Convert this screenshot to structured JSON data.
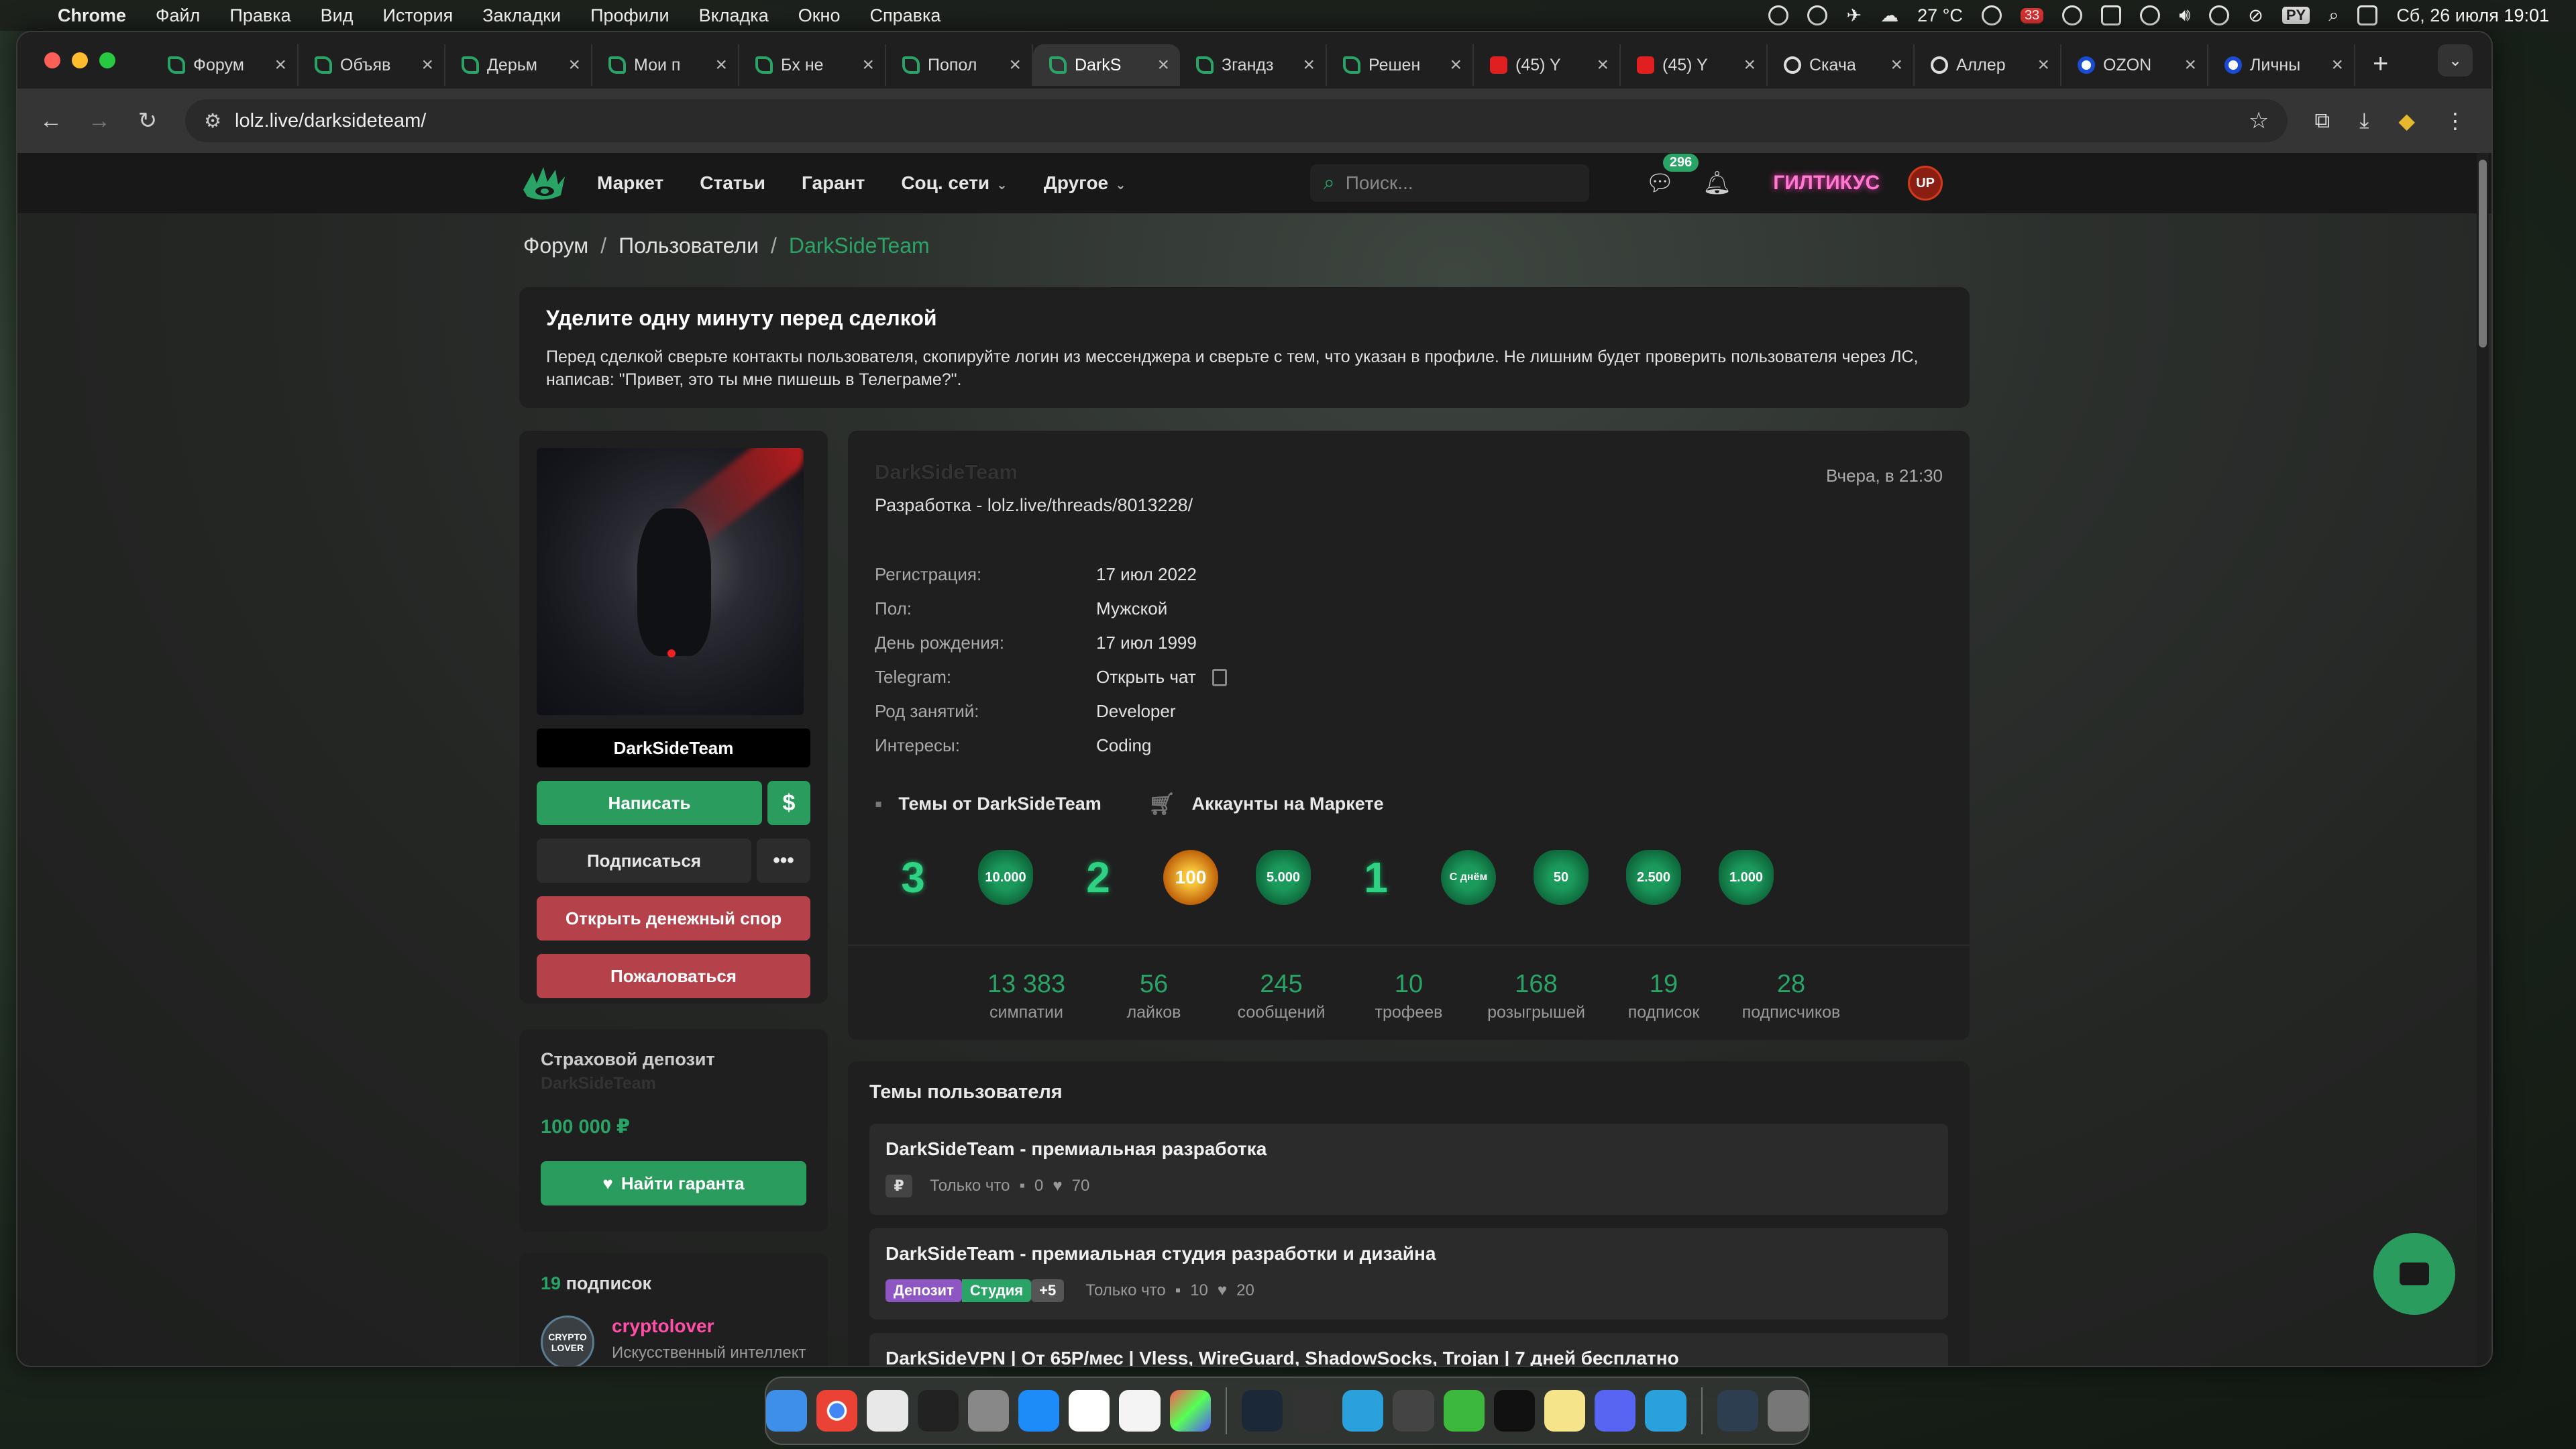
{
  "menubar": {
    "app_name": "Chrome",
    "items": [
      "Файл",
      "Правка",
      "Вид",
      "История",
      "Закладки",
      "Профили",
      "Вкладка",
      "Окно",
      "Справка"
    ],
    "temperature": "27 °C",
    "keyboard_layout": "PY",
    "datetime": "Сб, 26 июля 19:01",
    "notification_count": "33"
  },
  "browser": {
    "tabs": [
      {
        "title": "Форум",
        "favicon": "lolz-icon"
      },
      {
        "title": "Объяв",
        "favicon": "lolz-icon"
      },
      {
        "title": "Дерьм",
        "favicon": "lolz-icon"
      },
      {
        "title": "Мои п",
        "favicon": "lolz-icon"
      },
      {
        "title": "Бх не",
        "favicon": "lolz-icon"
      },
      {
        "title": "Попол",
        "favicon": "lolz-icon"
      },
      {
        "title": "DarkS",
        "favicon": "lolz-icon",
        "active": true
      },
      {
        "title": "Згандз",
        "favicon": "lolz-icon"
      },
      {
        "title": "Решен",
        "favicon": "lolz-icon"
      },
      {
        "title": "(45) Y",
        "favicon": "youtube-icon"
      },
      {
        "title": "(45) Y",
        "favicon": "youtube-icon"
      },
      {
        "title": "Скача",
        "favicon": "github-icon"
      },
      {
        "title": "Аллер",
        "favicon": "github-icon"
      },
      {
        "title": "OZON",
        "favicon": "ozon-icon"
      },
      {
        "title": "Личны",
        "favicon": "ozon-icon"
      }
    ],
    "url": "lolz.live/darksideteam/"
  },
  "site": {
    "nav": [
      "Маркет",
      "Статьи",
      "Гарант",
      "Соц. сети",
      "Другое"
    ],
    "search_placeholder": "Поиск...",
    "messages_badge": "296",
    "username": "ГИЛТИКУС",
    "avatar_text": "UP"
  },
  "breadcrumb": [
    "Форум",
    "Пользователи",
    "DarkSideTeam"
  ],
  "notice": {
    "title": "Уделите одну минуту перед сделкой",
    "text": "Перед сделкой сверьте контакты пользователя, скопируйте логин из мессенджера и сверьте с тем, что указан в профиле. Не лишним будет проверить пользователя через ЛС, написав: \"Привет, это ты мне пишешь в Телеграме?\"."
  },
  "sidebar": {
    "username": "DarkSideTeam",
    "write_button": "Написать",
    "money_button": "$",
    "subscribe_button": "Подписаться",
    "more_button": "•••",
    "dispute_button": "Открыть денежный спор",
    "report_button": "Пожаловаться",
    "deposit_title": "Страховой депозит",
    "deposit_name": "DarkSideTeam",
    "deposit_amount": "100 000 ₽",
    "guarantor_button": "Найти гаранта",
    "subs_count": "19",
    "subs_label": "подписок",
    "sub_user": {
      "name": "cryptolover",
      "desc": "Искусственный интеллект",
      "avatar_text": "CRYPTO LOVER"
    }
  },
  "profile": {
    "name": "DarkSideTeam",
    "status": "Разработка - lolz.live/threads/8013228/",
    "last_seen": "Вчера, в 21:30",
    "info": [
      {
        "k": "Регистрация:",
        "v": "17 июл 2022"
      },
      {
        "k": "Пол:",
        "v": "Мужской"
      },
      {
        "k": "День рождения:",
        "v": "17 июл 1999"
      },
      {
        "k": "Telegram:",
        "v": "Открыть чат"
      },
      {
        "k": "Род занятий:",
        "v": "Developer"
      },
      {
        "k": "Интересы:",
        "v": "Coding"
      }
    ],
    "link_topics": "Темы от DarkSideTeam",
    "link_market": "Аккаунты на Маркете",
    "trophies": [
      "3",
      "10.000",
      "2",
      "100",
      "5.000",
      "1",
      "С днём",
      "50",
      "2.500",
      "1.000"
    ],
    "stats": [
      {
        "v": "13 383",
        "k": "симпатии"
      },
      {
        "v": "56",
        "k": "лайков"
      },
      {
        "v": "245",
        "k": "сообщений"
      },
      {
        "v": "10",
        "k": "трофеев"
      },
      {
        "v": "168",
        "k": "розыгрышей"
      },
      {
        "v": "19",
        "k": "подписок"
      },
      {
        "v": "28",
        "k": "подписчиков"
      }
    ]
  },
  "topics": {
    "title": "Темы пользователя",
    "items": [
      {
        "title": "DarkSideTeam - премиальная разработка",
        "prefix": "₽",
        "time": "Только что",
        "replies": "0",
        "likes": "70"
      },
      {
        "title": "DarkSideTeam - премиальная студия разработки и дизайна",
        "chips": [
          "Депозит",
          "Студия",
          "+5"
        ],
        "time": "Только что",
        "replies": "10",
        "likes": "20"
      },
      {
        "title": "DarkSideVPN | От 65Р/мес | Vless, WireGuard, ShadowSocks, Trojan | 7 дней бесплатно"
      }
    ]
  },
  "colors": {
    "accent": "#2aa466",
    "danger": "#b5424a",
    "card": "#1f1f1f",
    "nav": "#181818"
  }
}
